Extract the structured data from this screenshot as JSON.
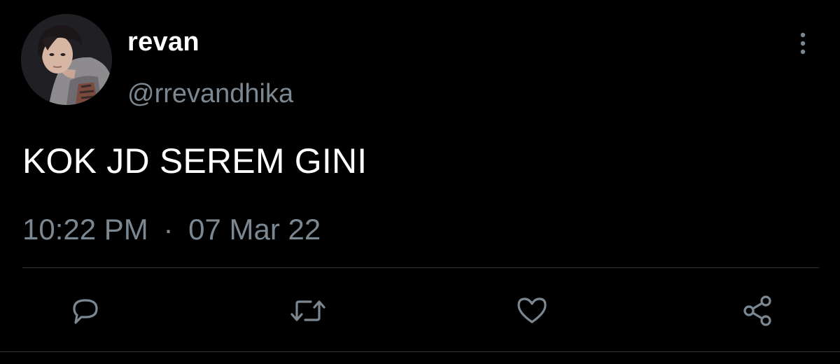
{
  "tweet": {
    "author": {
      "display_name": "revan",
      "handle": "@rrevandhika",
      "avatar_icon": "profile-photo"
    },
    "text": "KOK JD SEREM GINI",
    "time": "10:22 PM",
    "separator": "·",
    "date": "07 Mar 22",
    "more_icon": "more-vertical-icon"
  },
  "actions": [
    {
      "name": "reply",
      "icon": "reply-icon"
    },
    {
      "name": "retweet",
      "icon": "retweet-icon"
    },
    {
      "name": "like",
      "icon": "heart-icon"
    },
    {
      "name": "share",
      "icon": "share-icon"
    }
  ],
  "colors": {
    "background": "#000000",
    "primary_text": "#ffffff",
    "secondary_text": "#7b8791",
    "icon": "#7b8791",
    "divider": "#2f3336"
  }
}
